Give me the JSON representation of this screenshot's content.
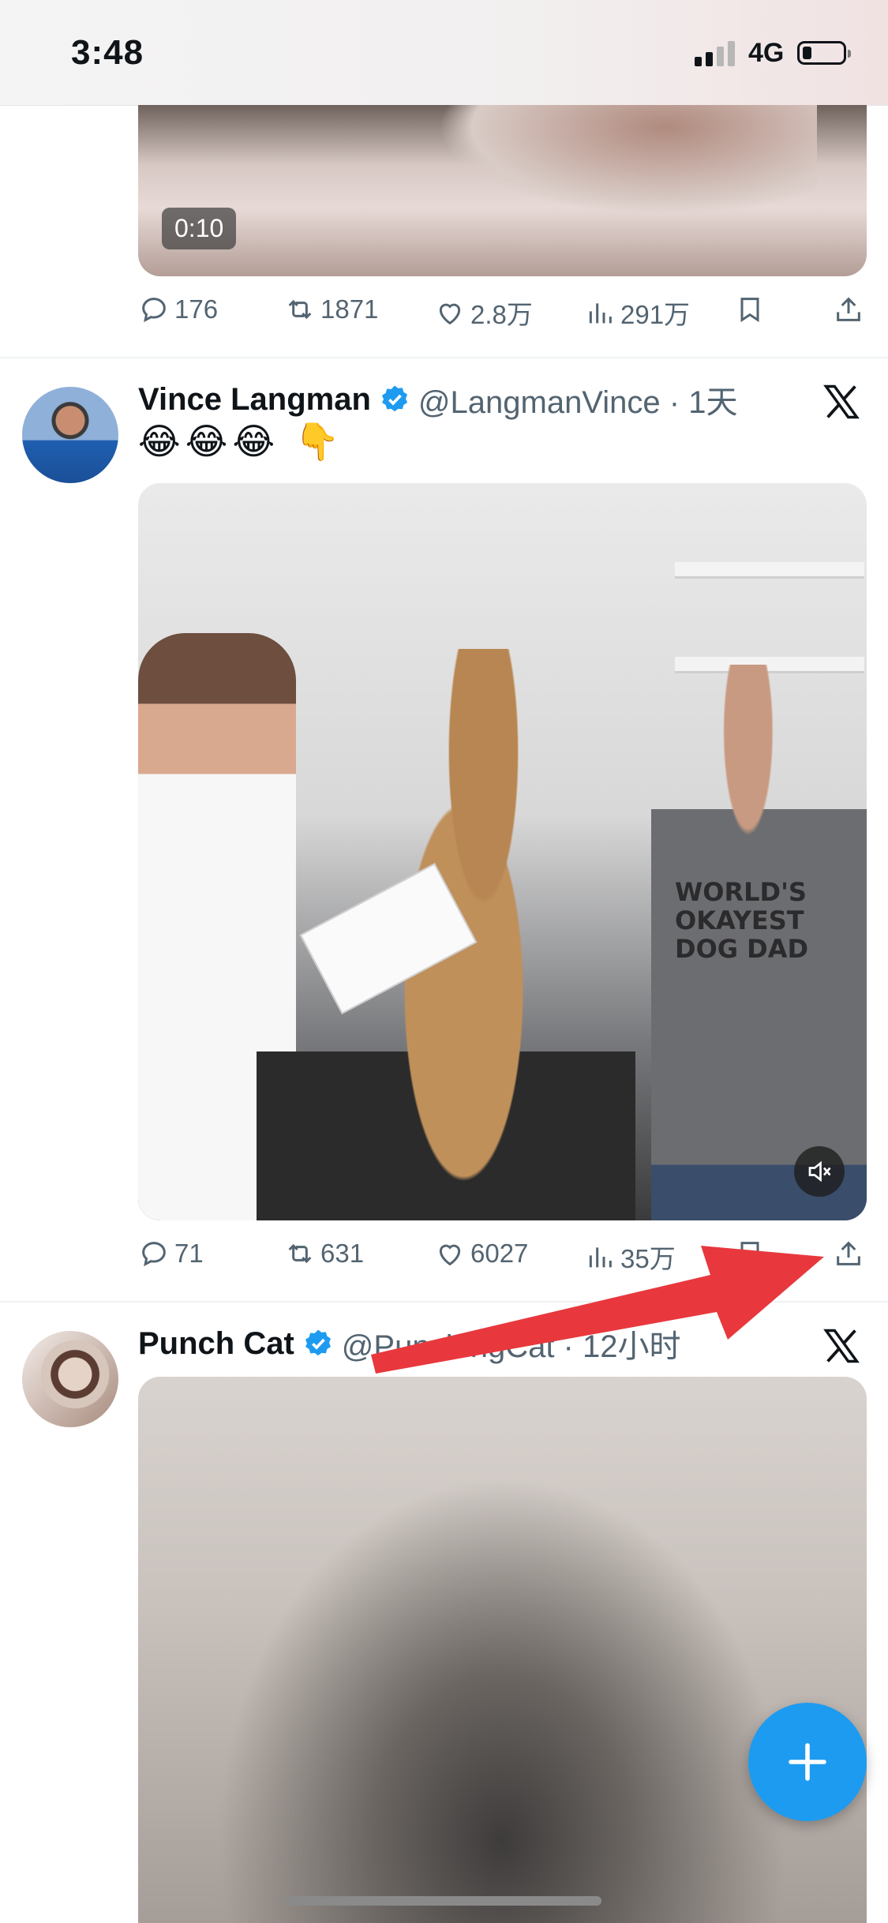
{
  "status_bar": {
    "time": "3:48",
    "network": "4G"
  },
  "tweets": [
    {
      "video_duration": "0:10",
      "stats": {
        "replies": "176",
        "reposts": "1871",
        "likes": "2.8万",
        "views": "291万"
      }
    },
    {
      "name": "Vince Langman",
      "handle_time": "@LangmanVince · 1天",
      "text": "😂😂😂 👇",
      "shirt_text": "WORLD'S OKAYEST DOG DAD",
      "stats": {
        "replies": "71",
        "reposts": "631",
        "likes": "6027",
        "views": "35万"
      }
    },
    {
      "name": "Punch Cat",
      "handle_time": "@PunchingCat · 12小时"
    }
  ],
  "colors": {
    "accent": "#1d9bf0",
    "arrow": "#e8383d",
    "muted_text": "#536471"
  }
}
